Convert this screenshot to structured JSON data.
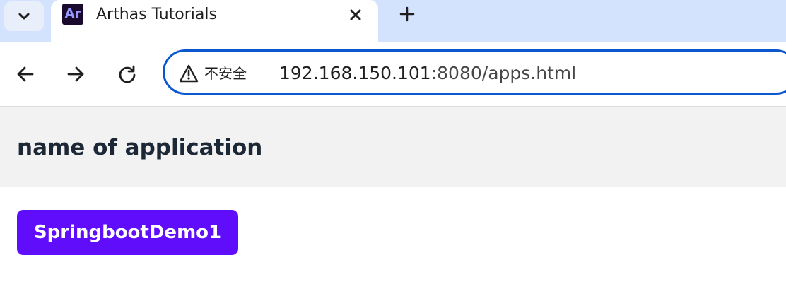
{
  "browser": {
    "tab": {
      "favicon_text": "Ar",
      "title": "Arthas Tutorials"
    },
    "icons": {
      "tab_search": "chevron-down-icon",
      "tab_close": "close-icon",
      "new_tab": "plus-icon",
      "back": "arrow-left-icon",
      "forward": "arrow-right-icon",
      "reload": "reload-icon",
      "security": "warning-icon"
    },
    "address_bar": {
      "security_label": "不安全",
      "url_host": "192.168.150.101",
      "url_rest": ":8080/apps.html"
    }
  },
  "page": {
    "header_title": "name of application",
    "apps": [
      {
        "name": "SpringbootDemo1"
      }
    ]
  },
  "colors": {
    "tabstrip_bg": "#d3e3fd",
    "omnibox_border": "#0b57d0",
    "header_bg": "#f2f2f2",
    "app_button_bg": "#5f0dfa",
    "title_color": "#1c2836"
  }
}
